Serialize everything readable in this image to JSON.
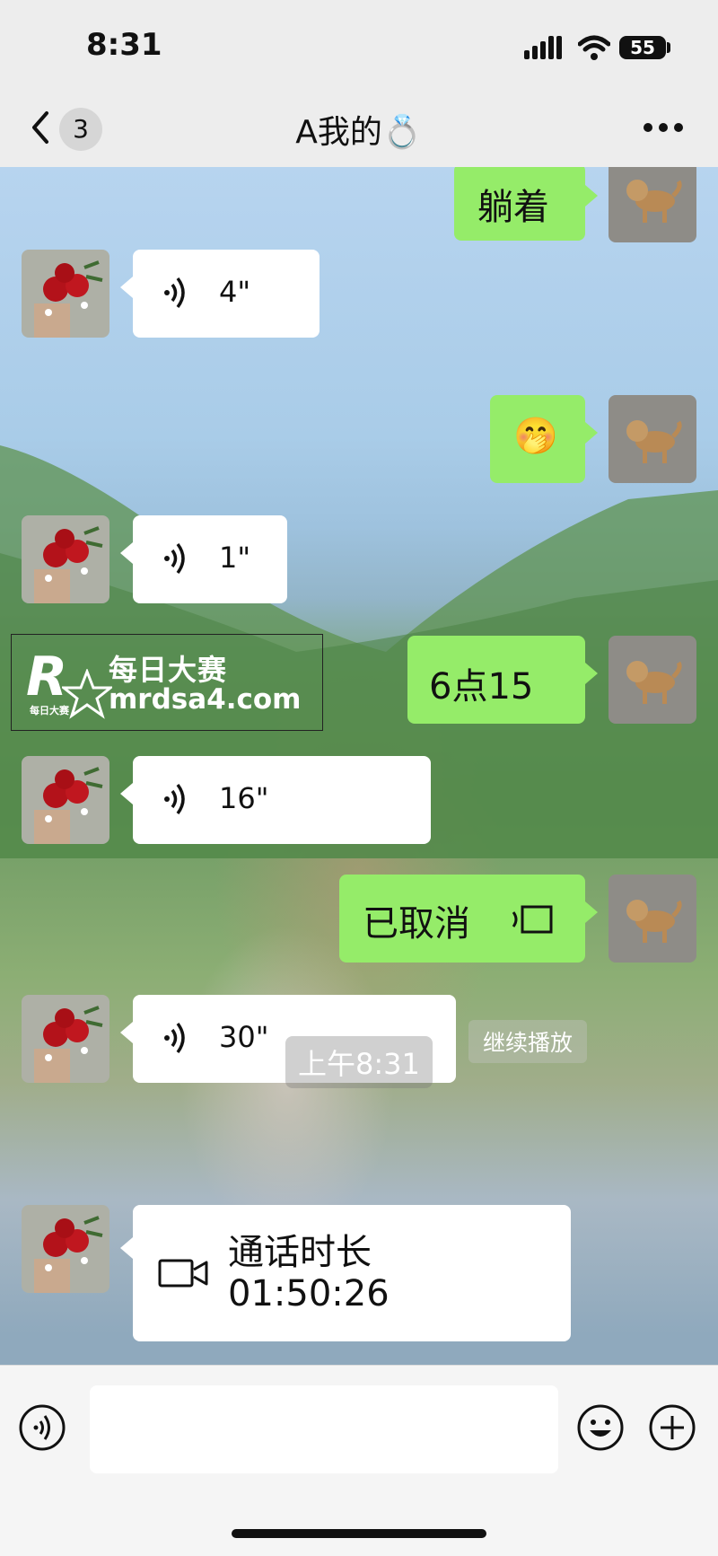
{
  "status": {
    "time": "8:31",
    "battery": "55"
  },
  "nav": {
    "unread_count": "3",
    "title": "A我的💍"
  },
  "messages": {
    "m1_text": "躺着",
    "m2_duration": "4\"",
    "m3_emoji": "🤭",
    "m4_duration": "1\"",
    "m5_text": "6点15",
    "m6_duration": "16\"",
    "m7_text": "已取消",
    "m8_duration": "30\"",
    "m8_hint": "继续播放",
    "timestamp": "上午8:31",
    "m9_title": "通话时长",
    "m9_duration": "01:50:26"
  },
  "watermark": {
    "initial": "R",
    "small_text": "每日大赛",
    "cn_text": "每日大赛",
    "url": "mrdsa4.com"
  },
  "icons": {
    "back": "chevron-left-icon",
    "more": "more-dots-icon",
    "voice": "voice-wave-icon",
    "video": "video-camera-icon",
    "voice_call_cancel": "voice-call-icon",
    "emoji": "smiley-icon",
    "plus": "plus-circle-icon"
  },
  "colors": {
    "outgoing_bubble": "#95ec69",
    "incoming_bubble": "#ffffff",
    "background": "#ededed"
  }
}
